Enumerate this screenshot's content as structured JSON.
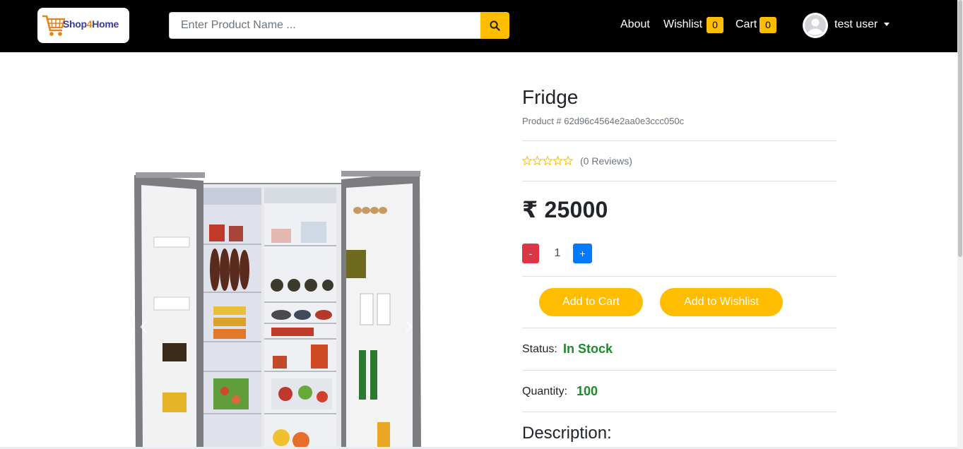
{
  "navbar": {
    "logo": {
      "part1": "Shop",
      "part2": "4",
      "part3": "Home"
    },
    "search": {
      "placeholder": "Enter Product Name ..."
    },
    "links": {
      "about": "About",
      "wishlist": "Wishlist",
      "wishlist_count": "0",
      "cart": "Cart",
      "cart_count": "0"
    },
    "user": {
      "name": "test user"
    }
  },
  "product": {
    "title": "Fridge",
    "id_text": "Product # 62d96c4564e2aa0e3ccc050c",
    "rating": 0,
    "rating_max": 5,
    "reviews_text": "(0 Reviews)",
    "price": "₹ 25000",
    "quantity": {
      "minus": "-",
      "value": "1",
      "plus": "+"
    },
    "add_to_cart": "Add to Cart",
    "add_to_wishlist": "Add to Wishlist",
    "status_label": "Status:",
    "status_value": "In Stock",
    "stock_label": "Quantity:",
    "stock_value": "100",
    "description_title": "Description:"
  },
  "colors": {
    "navbar_bg": "#000000",
    "accent": "#febd01",
    "minus_button": "#dc3545",
    "plus_button": "#007bff",
    "in_stock_text": "#1b8a2a"
  },
  "icons": {
    "search": "search-icon",
    "avatar": "user-avatar-icon",
    "caret": "caret-down-icon",
    "star": "star-outline-icon",
    "prev": "chevron-left-icon",
    "next": "chevron-right-icon",
    "logo_cart": "shopping-cart-icon"
  }
}
